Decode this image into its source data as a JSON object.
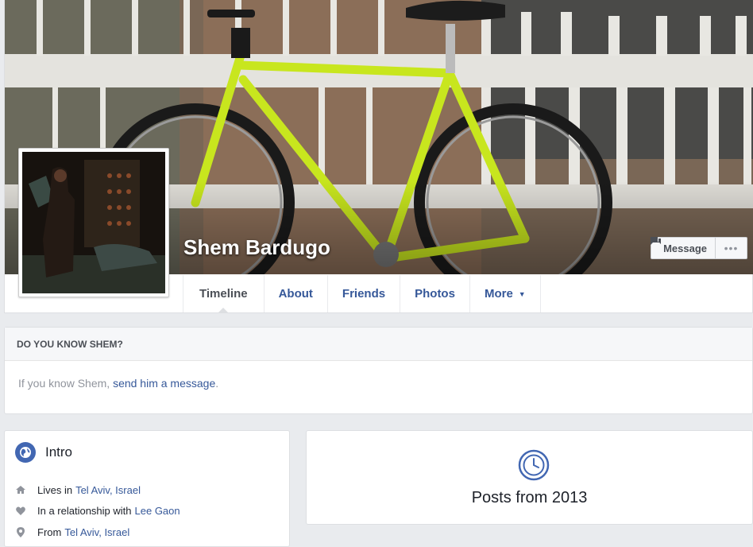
{
  "profile": {
    "name": "Shem Bardugo",
    "message_button": "Message",
    "more_button": "•••"
  },
  "tabs": [
    {
      "label": "Timeline",
      "active": true
    },
    {
      "label": "About"
    },
    {
      "label": "Friends"
    },
    {
      "label": "Photos"
    },
    {
      "label": "More"
    }
  ],
  "know": {
    "heading": "DO YOU KNOW SHEM?",
    "text_before": "If you know Shem, ",
    "link": "send him a message",
    "text_after": "."
  },
  "intro": {
    "title": "Intro",
    "items": [
      {
        "prefix": "Lives in",
        "link": "Tel Aviv, Israel",
        "icon": "home-icon"
      },
      {
        "prefix": "In a relationship with",
        "link": "Lee Gaon",
        "icon": "heart-icon"
      },
      {
        "prefix": "From",
        "link": "Tel Aviv, Israel",
        "icon": "location-pin-icon"
      }
    ]
  },
  "posts": {
    "label": "Posts from 2013",
    "icon": "clock-icon"
  },
  "colors": {
    "link": "#365899",
    "brand": "#4267b2",
    "background": "#e9ebee",
    "bike": "#c8e61e"
  }
}
